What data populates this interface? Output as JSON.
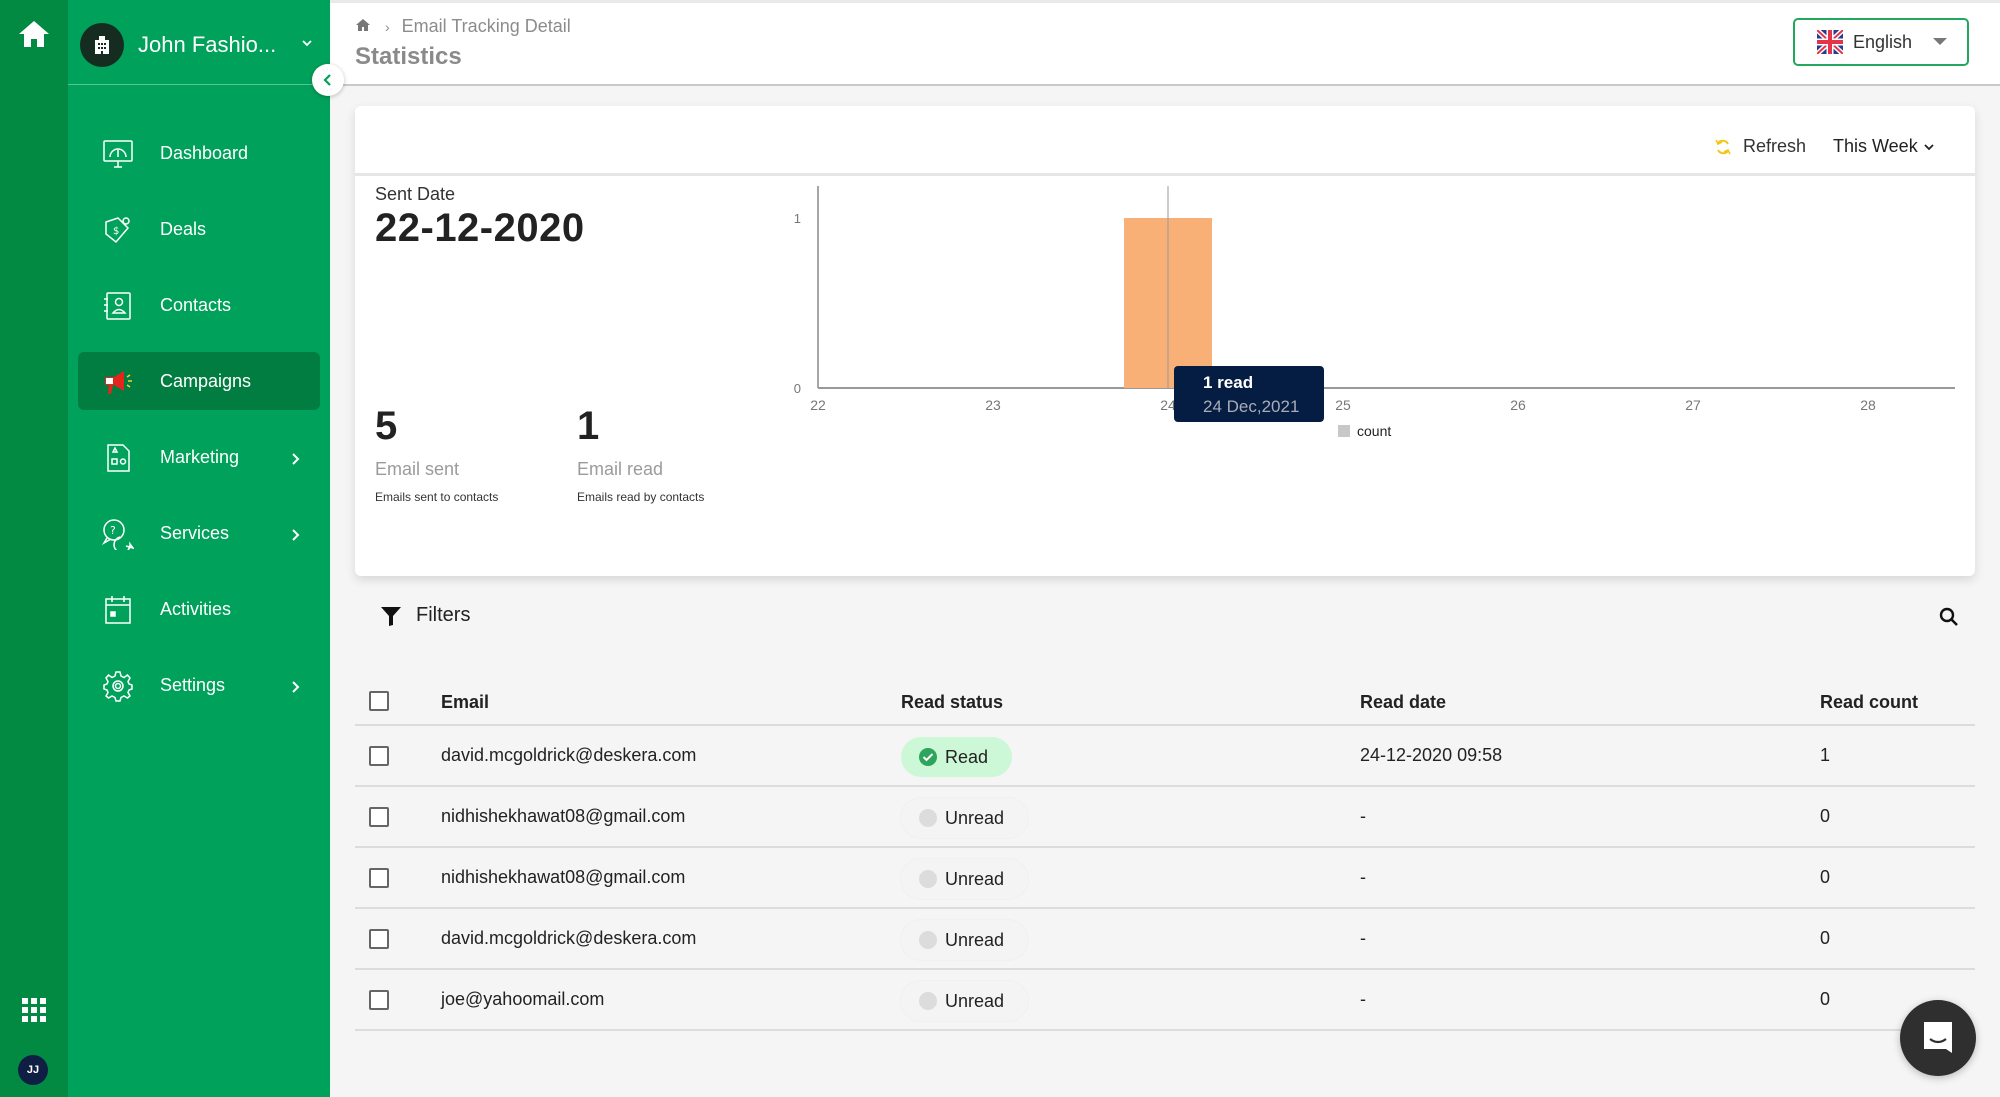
{
  "rail": {
    "home_icon": "home-icon",
    "apps_icon": "apps-grid-icon",
    "avatar_initials": "JJ"
  },
  "sidebar": {
    "org_name": "John Fashio...",
    "org_icon": "building-icon",
    "items": [
      {
        "label": "Dashboard",
        "icon": "dashboard-gauge-icon",
        "has_submenu": false,
        "active": false
      },
      {
        "label": "Deals",
        "icon": "price-tag-icon",
        "has_submenu": false,
        "active": false
      },
      {
        "label": "Contacts",
        "icon": "contact-book-icon",
        "has_submenu": false,
        "active": false
      },
      {
        "label": "Campaigns",
        "icon": "megaphone-icon",
        "has_submenu": false,
        "active": true
      },
      {
        "label": "Marketing",
        "icon": "marketing-shapes-icon",
        "has_submenu": true,
        "active": false
      },
      {
        "label": "Services",
        "icon": "help-chat-icon",
        "has_submenu": true,
        "active": false
      },
      {
        "label": "Activities",
        "icon": "calendar-icon",
        "has_submenu": false,
        "active": false
      },
      {
        "label": "Settings",
        "icon": "gear-icon",
        "has_submenu": true,
        "active": false
      }
    ]
  },
  "header": {
    "breadcrumb": [
      "Email Tracking Detail"
    ],
    "title": "Statistics",
    "language": "English"
  },
  "stats": {
    "refresh_label": "Refresh",
    "period": "This Week",
    "sent_date_label": "Sent Date",
    "sent_date": "22-12-2020",
    "email_sent": {
      "value": "5",
      "label": "Email sent",
      "sub": "Emails sent to contacts"
    },
    "email_read": {
      "value": "1",
      "label": "Email read",
      "sub": "Emails read by contacts"
    }
  },
  "chart_data": {
    "type": "bar",
    "title": "",
    "xlabel": "",
    "ylabel": "",
    "categories": [
      "22",
      "23",
      "24",
      "25",
      "26",
      "27",
      "28"
    ],
    "x": [
      22,
      23,
      24,
      25,
      26,
      27,
      28
    ],
    "series": [
      {
        "name": "count",
        "values": [
          0,
          0,
          1,
          0,
          0,
          0,
          0
        ],
        "color": "#f9b077"
      }
    ],
    "ylim": [
      0,
      1
    ],
    "yticks": [
      0,
      1
    ],
    "xlim": [
      22,
      28.5
    ],
    "grid": false,
    "legend": {
      "position": "bottom-center",
      "entries": [
        "count"
      ],
      "swatch_color": "#c8c8c8"
    },
    "tooltip": {
      "line1": "1  read",
      "line2": "24 Dec,2021",
      "x": 24
    }
  },
  "filters": {
    "label": "Filters"
  },
  "table": {
    "columns": [
      "Email",
      "Read status",
      "Read date",
      "Read count"
    ],
    "rows": [
      {
        "email": "david.mcgoldrick@deskera.com",
        "status": "Read",
        "read": true,
        "date": "24-12-2020 09:58",
        "count": "1"
      },
      {
        "email": "nidhishekhawat08@gmail.com",
        "status": "Unread",
        "read": false,
        "date": "-",
        "count": "0"
      },
      {
        "email": "nidhishekhawat08@gmail.com",
        "status": "Unread",
        "read": false,
        "date": "-",
        "count": "0"
      },
      {
        "email": "david.mcgoldrick@deskera.com",
        "status": "Unread",
        "read": false,
        "date": "-",
        "count": "0"
      },
      {
        "email": "joe@yahoomail.com",
        "status": "Unread",
        "read": false,
        "date": "-",
        "count": "0"
      }
    ]
  },
  "colors": {
    "sidebar_green": "#00a15a",
    "rail_green": "#028a43",
    "active_item": "#027d42",
    "bar_orange": "#f9b077",
    "tooltip_bg": "#051d42",
    "read_badge": "#cdf8d8"
  }
}
